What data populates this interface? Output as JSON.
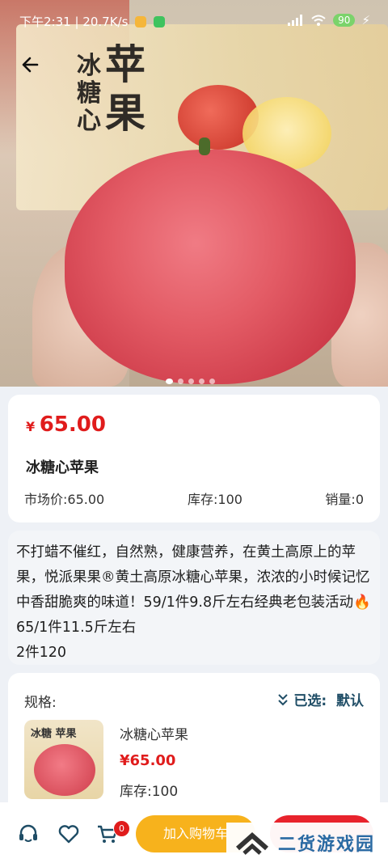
{
  "status_bar": {
    "time": "下午2:31",
    "speed": "20.7K/s",
    "battery": "90"
  },
  "hero": {
    "box_chars_left": "冰糖心",
    "box_chars_big": "苹果",
    "carousel_count": 5,
    "carousel_active": 0
  },
  "product": {
    "price_symbol": "¥",
    "price": "65.00",
    "name": "冰糖心苹果",
    "market_price": "市场价:65.00",
    "stock": "库存:100",
    "sales": "销量:0"
  },
  "description": {
    "text": "不打蜡不催红，自然熟，健康营养，在黄土高原上的苹果，悦派果果®黄土高原冰糖心苹果，浓浓的小时候记忆中香甜脆爽的味道！59/1件9.8斤左右经典老包装活动🔥65/1件11.5斤左右\n2件120"
  },
  "spec": {
    "label": "规格:",
    "selected": "已选:  默认",
    "item_name": "冰糖心苹果",
    "item_price": "¥65.00",
    "item_stock": "库存:100",
    "thumb_chars": "冰糖 苹果"
  },
  "bottom_bar": {
    "cart_count": "0",
    "add_to_cart": "加入购物车"
  },
  "watermark": {
    "text": "二货游戏园"
  },
  "colors": {
    "price_red": "#e01c1c",
    "add_cart_orange": "#f7b21c",
    "buy_red": "#e8232c",
    "accent_teal": "#1f4d66"
  }
}
